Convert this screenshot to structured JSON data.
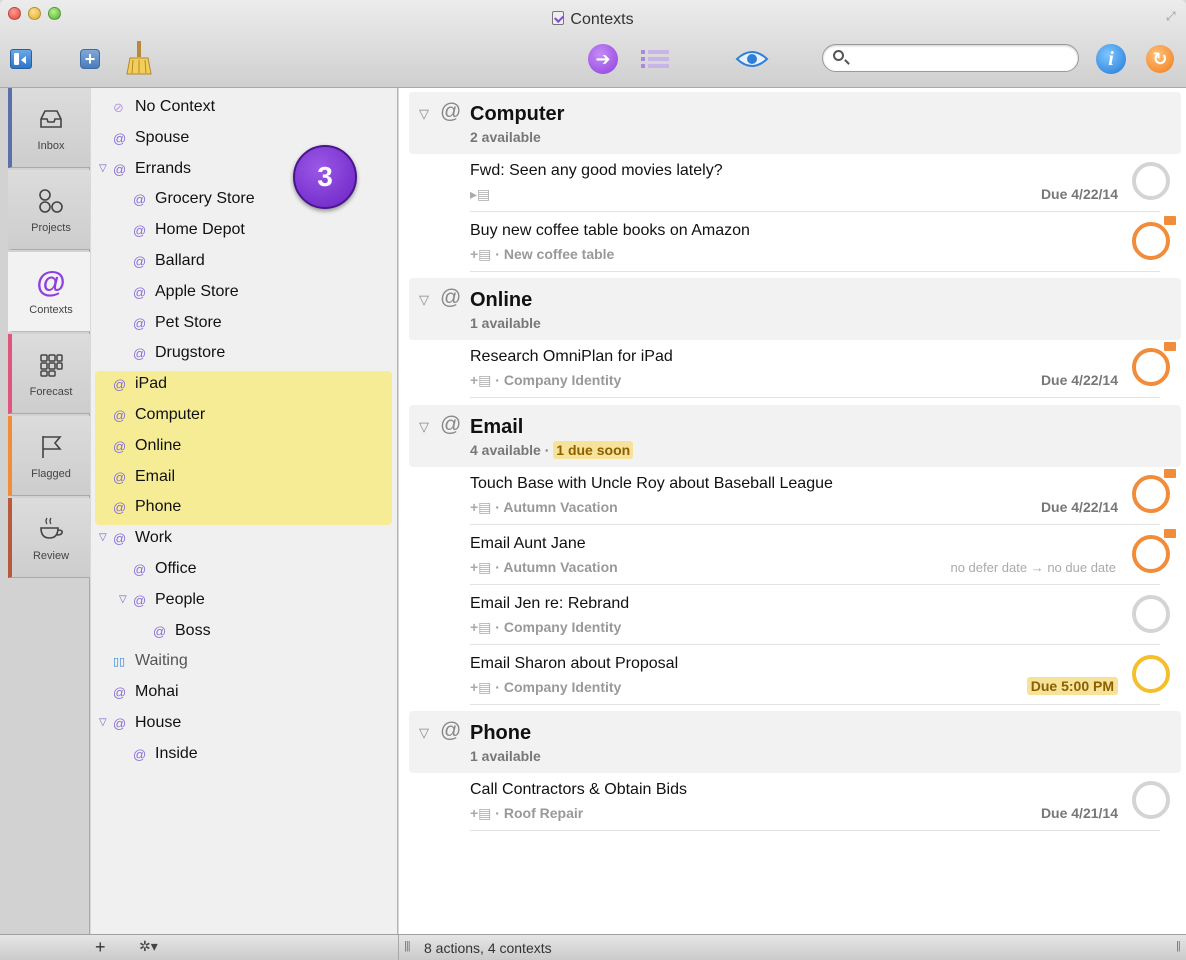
{
  "window": {
    "title": "Contexts"
  },
  "toolbar": {
    "search_placeholder": "",
    "inspector_glyph": "i"
  },
  "perspectives": [
    {
      "label": "Inbox",
      "icon": "inbox-icon"
    },
    {
      "label": "Projects",
      "icon": "projects-icon"
    },
    {
      "label": "Contexts",
      "icon": "at-sign-icon"
    },
    {
      "label": "Forecast",
      "icon": "forecast-grid-icon"
    },
    {
      "label": "Flagged",
      "icon": "flag-icon"
    },
    {
      "label": "Review",
      "icon": "coffee-cup-icon"
    }
  ],
  "contexts": [
    {
      "label": "No Context",
      "indent": 0,
      "disclosure": false,
      "icon": "no-context-icon"
    },
    {
      "label": "Spouse",
      "indent": 0,
      "disclosure": false,
      "icon": "at-icon"
    },
    {
      "label": "Errands",
      "indent": 0,
      "disclosure": true,
      "icon": "at-icon"
    },
    {
      "label": "Grocery Store",
      "indent": 1,
      "disclosure": false,
      "icon": "at-icon"
    },
    {
      "label": "Home Depot",
      "indent": 1,
      "disclosure": false,
      "icon": "at-icon"
    },
    {
      "label": "Ballard",
      "indent": 1,
      "disclosure": false,
      "icon": "at-icon"
    },
    {
      "label": "Apple Store",
      "indent": 1,
      "disclosure": false,
      "icon": "at-icon"
    },
    {
      "label": "Pet Store",
      "indent": 1,
      "disclosure": false,
      "icon": "at-icon"
    },
    {
      "label": "Drugstore",
      "indent": 1,
      "disclosure": false,
      "icon": "at-icon"
    },
    {
      "label": "iPad",
      "indent": 0,
      "disclosure": false,
      "icon": "at-icon",
      "highlighted": true
    },
    {
      "label": "Computer",
      "indent": 0,
      "disclosure": false,
      "icon": "at-icon",
      "highlighted": true
    },
    {
      "label": "Online",
      "indent": 0,
      "disclosure": false,
      "icon": "at-icon",
      "highlighted": true
    },
    {
      "label": "Email",
      "indent": 0,
      "disclosure": false,
      "icon": "at-icon",
      "highlighted": true
    },
    {
      "label": "Phone",
      "indent": 0,
      "disclosure": false,
      "icon": "at-icon",
      "highlighted": true
    },
    {
      "label": "Work",
      "indent": 0,
      "disclosure": true,
      "icon": "at-icon"
    },
    {
      "label": "Office",
      "indent": 1,
      "disclosure": false,
      "icon": "at-icon"
    },
    {
      "label": "People",
      "indent": 1,
      "disclosure": true,
      "icon": "at-icon"
    },
    {
      "label": "Boss",
      "indent": 2,
      "disclosure": false,
      "icon": "at-icon"
    },
    {
      "label": "Waiting",
      "indent": 0,
      "disclosure": false,
      "icon": "waiting-icon",
      "muted": true
    },
    {
      "label": "Mohai",
      "indent": 0,
      "disclosure": false,
      "icon": "at-icon"
    },
    {
      "label": "House",
      "indent": 0,
      "disclosure": true,
      "icon": "at-icon"
    },
    {
      "label": "Inside",
      "indent": 1,
      "disclosure": false,
      "icon": "at-icon"
    }
  ],
  "badge": {
    "number": "3"
  },
  "groups": [
    {
      "title": "Computer",
      "subtitle": "2 available",
      "soon": "",
      "actions": [
        {
          "title": "Fwd: Seen any good movies lately?",
          "project": "",
          "due": "Due 4/22/14",
          "due_soon": false,
          "defer": "",
          "flagged": false,
          "soon": false
        },
        {
          "title": "Buy new coffee table books on Amazon",
          "project": "New coffee table",
          "due": "",
          "due_soon": false,
          "defer": "",
          "flagged": true,
          "soon": false
        }
      ]
    },
    {
      "title": "Online",
      "subtitle": "1 available",
      "soon": "",
      "actions": [
        {
          "title": "Research OmniPlan for iPad",
          "project": "Company Identity",
          "due": "Due 4/22/14",
          "due_soon": false,
          "defer": "",
          "flagged": true,
          "soon": false
        }
      ]
    },
    {
      "title": "Email",
      "subtitle": "4 available",
      "soon": "1 due soon",
      "actions": [
        {
          "title": "Touch Base with Uncle Roy about Baseball League",
          "project": "Autumn Vacation",
          "due": "Due 4/22/14",
          "due_soon": false,
          "defer": "",
          "flagged": true,
          "soon": false
        },
        {
          "title": "Email Aunt Jane",
          "project": "Autumn Vacation",
          "due": "",
          "due_soon": false,
          "defer": "no defer date → no due date",
          "flagged": true,
          "soon": false
        },
        {
          "title": "Email Jen re: Rebrand",
          "project": "Company Identity",
          "due": "",
          "due_soon": false,
          "defer": "",
          "flagged": false,
          "soon": false
        },
        {
          "title": "Email Sharon about Proposal",
          "project": "Company Identity",
          "due": "Due 5:00 PM",
          "due_soon": true,
          "defer": "",
          "flagged": false,
          "soon": true
        }
      ]
    },
    {
      "title": "Phone",
      "subtitle": "1 available",
      "soon": "",
      "actions": [
        {
          "title": "Call Contractors & Obtain Bids",
          "project": "Roof Repair",
          "due": "Due 4/21/14",
          "due_soon": false,
          "defer": "",
          "flagged": false,
          "soon": false
        }
      ]
    }
  ],
  "status": {
    "text": "8 actions, 4 contexts"
  },
  "colors": {
    "accent": "#8e3fde",
    "flag": "#f08c3a",
    "due_soon": "#f4bf2a",
    "highlight": "#f6ec96"
  }
}
